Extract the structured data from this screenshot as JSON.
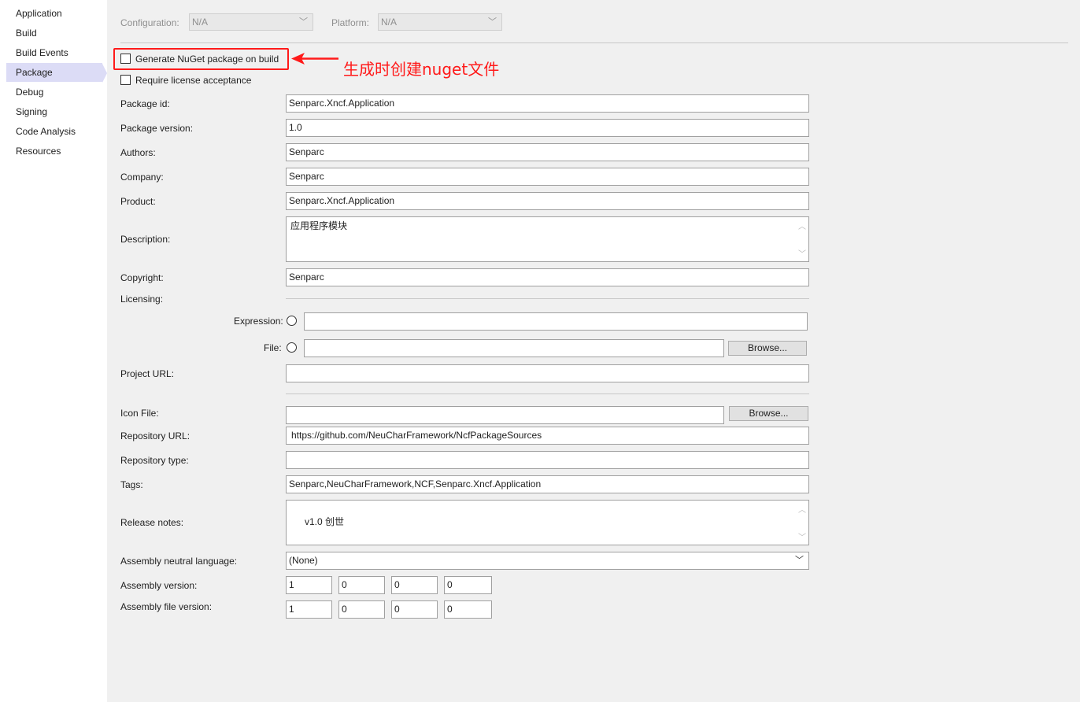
{
  "sidebar": {
    "items": [
      {
        "label": "Application"
      },
      {
        "label": "Build"
      },
      {
        "label": "Build Events"
      },
      {
        "label": "Package"
      },
      {
        "label": "Debug"
      },
      {
        "label": "Signing"
      },
      {
        "label": "Code Analysis"
      },
      {
        "label": "Resources"
      }
    ],
    "active": "Package"
  },
  "top": {
    "configuration_label": "Configuration:",
    "configuration_value": "N/A",
    "platform_label": "Platform:",
    "platform_value": "N/A"
  },
  "options": {
    "generate_nuget_label": "Generate NuGet package on build",
    "generate_nuget_checked": false,
    "require_license_label": "Require license acceptance",
    "require_license_checked": false
  },
  "annotation": {
    "text": "生成时创建nuget文件",
    "color": "#ff1a1a"
  },
  "fields": {
    "package_id": {
      "label": "Package id:",
      "value": "Senparc.Xncf.Application"
    },
    "package_version": {
      "label": "Package version:",
      "value": "1.0"
    },
    "authors": {
      "label": "Authors:",
      "value": "Senparc"
    },
    "company": {
      "label": "Company:",
      "value": "Senparc"
    },
    "product": {
      "label": "Product:",
      "value": "Senparc.Xncf.Application"
    },
    "description": {
      "label": "Description:",
      "value": "应用程序模块"
    },
    "copyright": {
      "label": "Copyright:",
      "value": "Senparc"
    },
    "licensing": {
      "label": "Licensing:"
    },
    "expression": {
      "label": "Expression:",
      "value": ""
    },
    "file": {
      "label": "File:",
      "value": "",
      "browse": "Browse..."
    },
    "project_url": {
      "label": "Project URL:",
      "value": ""
    },
    "icon_file": {
      "label": "Icon File:",
      "value": "",
      "browse": "Browse..."
    },
    "repository_url": {
      "label": "Repository URL:",
      "value": "https://github.com/NeuCharFramework/NcfPackageSources"
    },
    "repository_type": {
      "label": "Repository type:",
      "value": ""
    },
    "tags": {
      "label": "Tags:",
      "value": "Senparc,NeuCharFramework,NCF,Senparc.Xncf.Application"
    },
    "release_notes": {
      "label": "Release notes:",
      "value": "v1.0 创世"
    },
    "neutral_language": {
      "label": "Assembly neutral language:",
      "value": "(None)"
    },
    "assembly_version": {
      "label": "Assembly version:",
      "values": [
        "1",
        "0",
        "0",
        "0"
      ]
    },
    "assembly_file_version": {
      "label": "Assembly file version:",
      "values": [
        "1",
        "0",
        "0",
        "0"
      ]
    }
  }
}
